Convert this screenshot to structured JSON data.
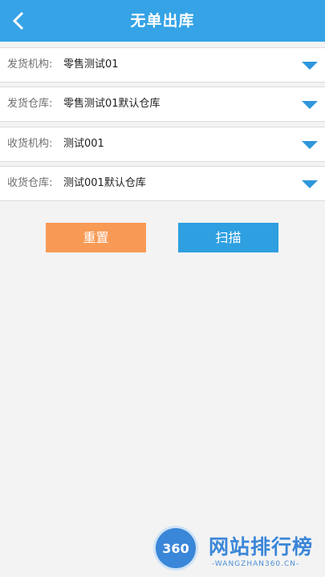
{
  "header": {
    "title": "无单出库",
    "back_icon": "chevron-left-icon"
  },
  "form": {
    "rows": [
      {
        "label": "发货机构:",
        "value": "零售测试01"
      },
      {
        "label": "发货仓库:",
        "value": "零售测试01默认仓库"
      },
      {
        "label": "收货机构:",
        "value": "测试001"
      },
      {
        "label": "收货仓库:",
        "value": "测试001默认仓库"
      }
    ]
  },
  "buttons": {
    "reset": "重置",
    "scan": "扫描"
  },
  "watermark": {
    "logo": "360",
    "title": "网站排行榜",
    "subtitle": "-WANGZHAN360.CN-"
  },
  "colors": {
    "header": "#35a3e6",
    "reset": "#f79a55",
    "scan": "#2e9fe0",
    "arrow": "#2f97dc"
  }
}
